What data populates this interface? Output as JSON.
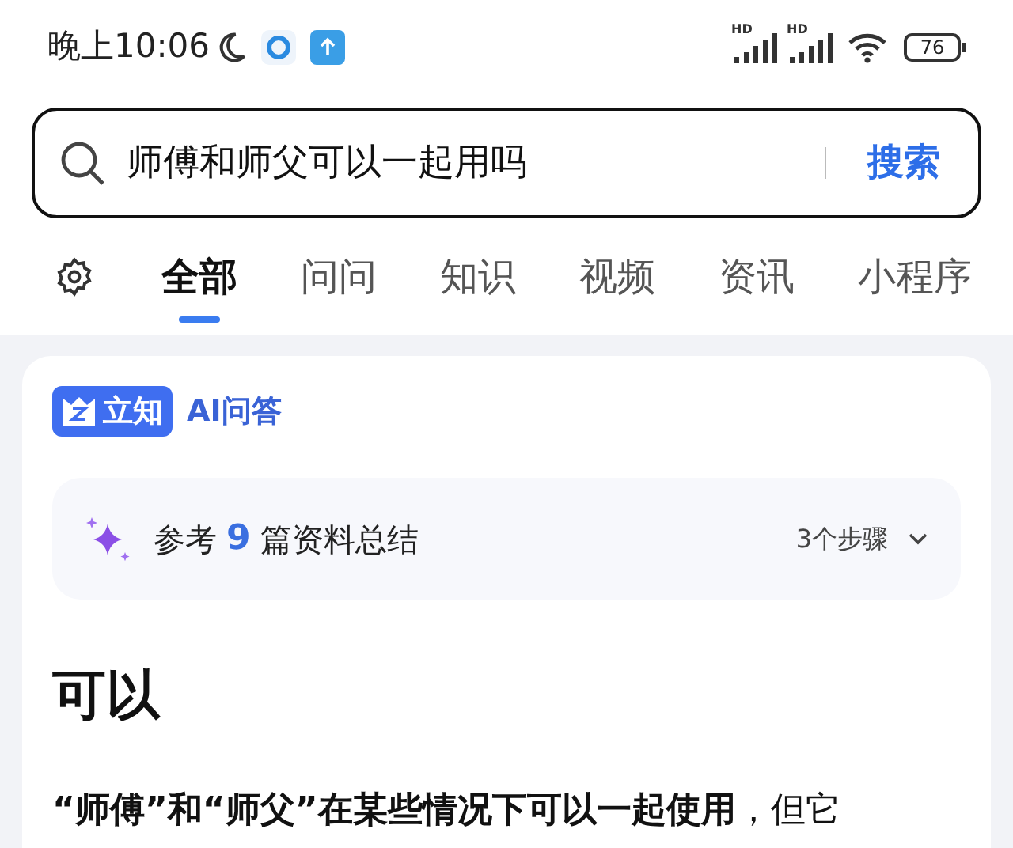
{
  "status_bar": {
    "time": "晚上10:06",
    "signals": [
      {
        "label": "HD"
      },
      {
        "label": "HD"
      }
    ],
    "battery": "76"
  },
  "search": {
    "value": "师傅和师父可以一起用吗",
    "button": "搜索"
  },
  "tabs": [
    {
      "label": "全部",
      "selected": true
    },
    {
      "label": "问问",
      "selected": false
    },
    {
      "label": "知识",
      "selected": false
    },
    {
      "label": "视频",
      "selected": false
    },
    {
      "label": "资讯",
      "selected": false
    },
    {
      "label": "小程序",
      "selected": false
    }
  ],
  "answer": {
    "brand": "立知",
    "brand_label": "AI问答",
    "summary": {
      "prefix": "参考",
      "count": "9",
      "suffix": "篇资料总结",
      "steps": "3个步骤"
    },
    "heading": "可以",
    "paragraph": "**“师傅”和“师父”在某些情况下可以一起使用**，但它"
  }
}
